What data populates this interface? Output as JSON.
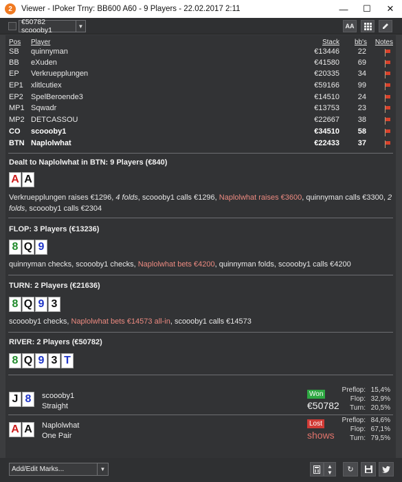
{
  "window": {
    "title": "Viewer - IPoker Trny: BB600 A60 - 9 Players - 22.02.2017 2:11",
    "minimize": "—",
    "maximize": "☐",
    "close": "✕"
  },
  "toolbar": {
    "hand_select": "€50782 scoooby1",
    "btn_aa": "AA",
    "grid_icon": "grid-icon",
    "edit_icon": "pencil-icon"
  },
  "players_header": {
    "pos": "Pos",
    "player": "Player",
    "stack": "Stack",
    "bbs": "bb's",
    "notes": "Notes"
  },
  "players": [
    {
      "pos": "SB",
      "name": "quinnyman",
      "stack": "€13446",
      "bbs": "22"
    },
    {
      "pos": "BB",
      "name": "eXuden",
      "stack": "€41580",
      "bbs": "69"
    },
    {
      "pos": "EP",
      "name": "Verkruepplungen",
      "stack": "€20335",
      "bbs": "34"
    },
    {
      "pos": "EP1",
      "name": "xlitlcutiex",
      "stack": "€59166",
      "bbs": "99"
    },
    {
      "pos": "EP2",
      "name": "SpelBeroende3",
      "stack": "€14510",
      "bbs": "24"
    },
    {
      "pos": "MP1",
      "name": "Sqwadr",
      "stack": "€13753",
      "bbs": "23"
    },
    {
      "pos": "MP2",
      "name": "DETCASSOU",
      "stack": "€22667",
      "bbs": "38"
    },
    {
      "pos": "CO",
      "name": "scoooby1",
      "stack": "€34510",
      "bbs": "58"
    },
    {
      "pos": "BTN",
      "name": "Naplolwhat",
      "stack": "€22433",
      "bbs": "37"
    }
  ],
  "preflop": {
    "title": "Dealt to Naplolwhat in BTN: 9 Players (€840)",
    "cards": [
      {
        "rank": "A",
        "color": "#cc1a1a"
      },
      {
        "rank": "A",
        "color": "#111111"
      }
    ],
    "a1": "Verkruepplungen raises €1296, ",
    "a2": "4 folds",
    "a3": ", scoooby1 calls €1296, ",
    "a4": "Naplolwhat raises €3600",
    "a5": ", quinnyman calls €3300, ",
    "a6": "2 folds",
    "a7": ", scoooby1 calls €2304"
  },
  "flop": {
    "title": "FLOP: 3 Players (€13236)",
    "cards": [
      {
        "rank": "8",
        "color": "#1f8a2a"
      },
      {
        "rank": "Q",
        "color": "#111111"
      },
      {
        "rank": "9",
        "color": "#1f35c8"
      }
    ],
    "a1": "quinnyman checks, scoooby1 checks, ",
    "a2": "Naplolwhat bets €4200",
    "a3": ", quinnyman folds, scoooby1 calls €4200"
  },
  "turn": {
    "title": "TURN: 2 Players (€21636)",
    "cards": [
      {
        "rank": "8",
        "color": "#1f8a2a"
      },
      {
        "rank": "Q",
        "color": "#111111"
      },
      {
        "rank": "9",
        "color": "#1f35c8"
      },
      {
        "rank": "3",
        "color": "#111111"
      }
    ],
    "a1": "scoooby1 checks, ",
    "a2": "Naplolwhat bets €14573 all-in",
    "a3": ", scoooby1 calls €14573"
  },
  "river": {
    "title": "RIVER: 2 Players (€50782)",
    "cards": [
      {
        "rank": "8",
        "color": "#1f8a2a"
      },
      {
        "rank": "Q",
        "color": "#111111"
      },
      {
        "rank": "9",
        "color": "#1f35c8"
      },
      {
        "rank": "3",
        "color": "#111111"
      },
      {
        "rank": "T",
        "color": "#1f35c8"
      }
    ]
  },
  "results": [
    {
      "cards": [
        {
          "rank": "J",
          "color": "#111111"
        },
        {
          "rank": "8",
          "color": "#1f35c8"
        }
      ],
      "name": "scoooby1",
      "hand": "Straight",
      "badge": "Won",
      "amount": "€50782",
      "stats": [
        {
          "label": "Preflop:",
          "value": "15,4%"
        },
        {
          "label": "Flop:",
          "value": "32,9%"
        },
        {
          "label": "Turn:",
          "value": "20,5%"
        }
      ]
    },
    {
      "cards": [
        {
          "rank": "A",
          "color": "#cc1a1a"
        },
        {
          "rank": "A",
          "color": "#111111"
        }
      ],
      "name": "Naplolwhat",
      "hand": "One Pair",
      "badge": "Lost",
      "amount": "shows",
      "stats": [
        {
          "label": "Preflop:",
          "value": "84,6%"
        },
        {
          "label": "Flop:",
          "value": "67,1%"
        },
        {
          "label": "Turn:",
          "value": "79,5%"
        }
      ]
    }
  ],
  "footer": {
    "marks_label": "Add/Edit Marks...",
    "icons": [
      "calculator-icon",
      "sort-icon",
      "refresh-icon",
      "save-icon",
      "twitter-icon"
    ]
  }
}
